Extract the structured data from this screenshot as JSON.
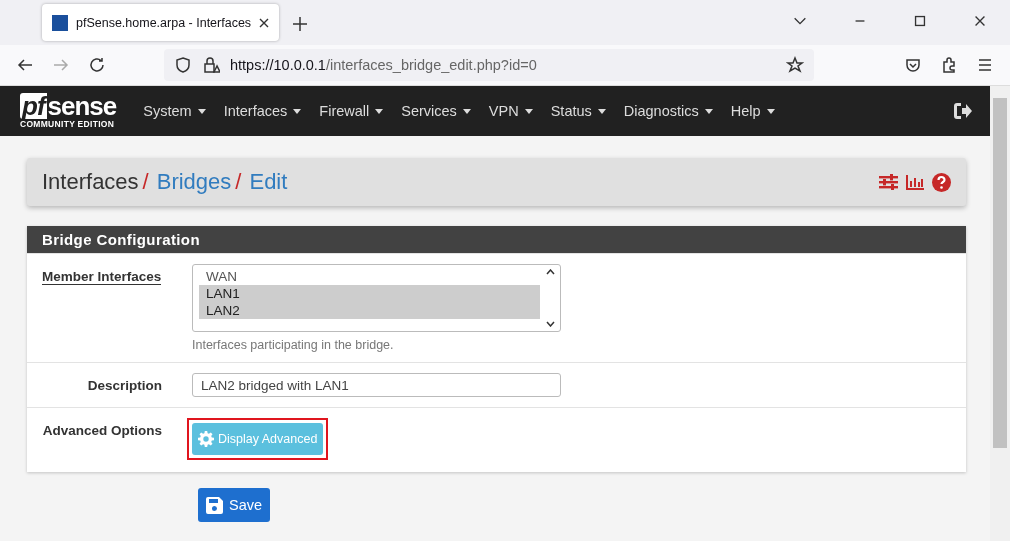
{
  "browser": {
    "tab_title": "pfSense.home.arpa - Interfaces",
    "url_host": "https://10.0.0.1",
    "url_path": "/interfaces_bridge_edit.php?id=0"
  },
  "navbar": {
    "logo": "sense",
    "logo_mark": "pf",
    "edition": "COMMUNITY EDITION",
    "menus": [
      {
        "label": "System"
      },
      {
        "label": "Interfaces"
      },
      {
        "label": "Firewall"
      },
      {
        "label": "Services"
      },
      {
        "label": "VPN"
      },
      {
        "label": "Status"
      },
      {
        "label": "Diagnostics"
      },
      {
        "label": "Help"
      }
    ]
  },
  "breadcrumb": [
    {
      "label": "Interfaces",
      "link": false,
      "separator": "/"
    },
    {
      "label": "Bridges",
      "link": true,
      "separator": "/"
    },
    {
      "label": "Edit",
      "link": true
    }
  ],
  "panel": {
    "title": "Bridge Configuration",
    "rows": [
      {
        "kind": "multiselect",
        "label": "Member Interfaces",
        "options": [
          {
            "label": "WAN",
            "selected": false
          },
          {
            "label": "LAN1",
            "selected": true
          },
          {
            "label": "LAN2",
            "selected": true
          }
        ],
        "help": "Interfaces participating in the bridge."
      },
      {
        "kind": "text",
        "label": "Description",
        "value": "LAN2 bridged with LAN1"
      },
      {
        "kind": "button",
        "label": "Advanced Options",
        "button": "Display Advanced",
        "highlighted": true
      }
    ]
  },
  "save_button": "Save"
}
